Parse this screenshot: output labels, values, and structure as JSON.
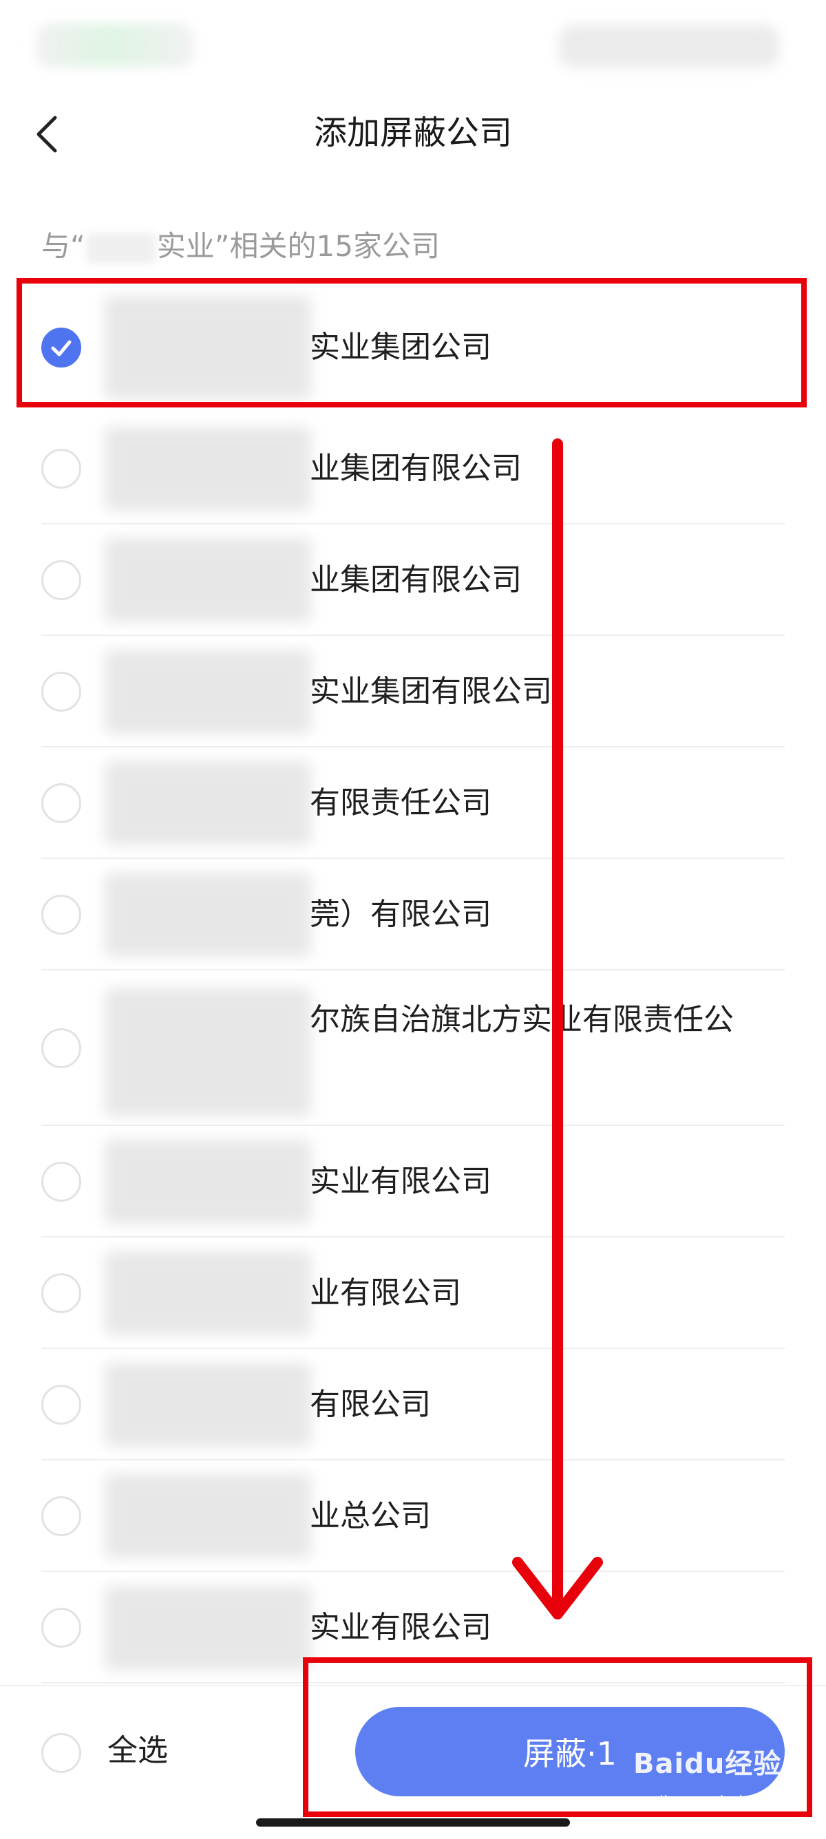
{
  "header": {
    "title": "添加屏蔽公司"
  },
  "subtitle": {
    "prefix": "与“",
    "suffix": "实业”相关的15家公司"
  },
  "companies": [
    {
      "name": "实业集团公司",
      "checked": true
    },
    {
      "name": "业集团有限公司",
      "checked": false
    },
    {
      "name": "业集团有限公司",
      "checked": false
    },
    {
      "name": "实业集团有限公司",
      "checked": false
    },
    {
      "name": "有限责任公司",
      "checked": false
    },
    {
      "name": "莞）有限公司",
      "checked": false
    },
    {
      "name": "尔族自治旗北方实业有限责任公",
      "checked": false
    },
    {
      "name": "实业有限公司",
      "checked": false
    },
    {
      "name": "业有限公司",
      "checked": false
    },
    {
      "name": "有限公司",
      "checked": false
    },
    {
      "name": "业总公司",
      "checked": false
    },
    {
      "name": "实业有限公司",
      "checked": false
    }
  ],
  "footer": {
    "select_all_label": "全选",
    "block_button_label": "屏蔽·1"
  },
  "watermark": {
    "brand": "Baidu经验",
    "url": "jingyan.baidu.com"
  },
  "colors": {
    "accent": "#5d7ff2",
    "checked": "#4f74f0",
    "annotation": "#e8000b"
  }
}
